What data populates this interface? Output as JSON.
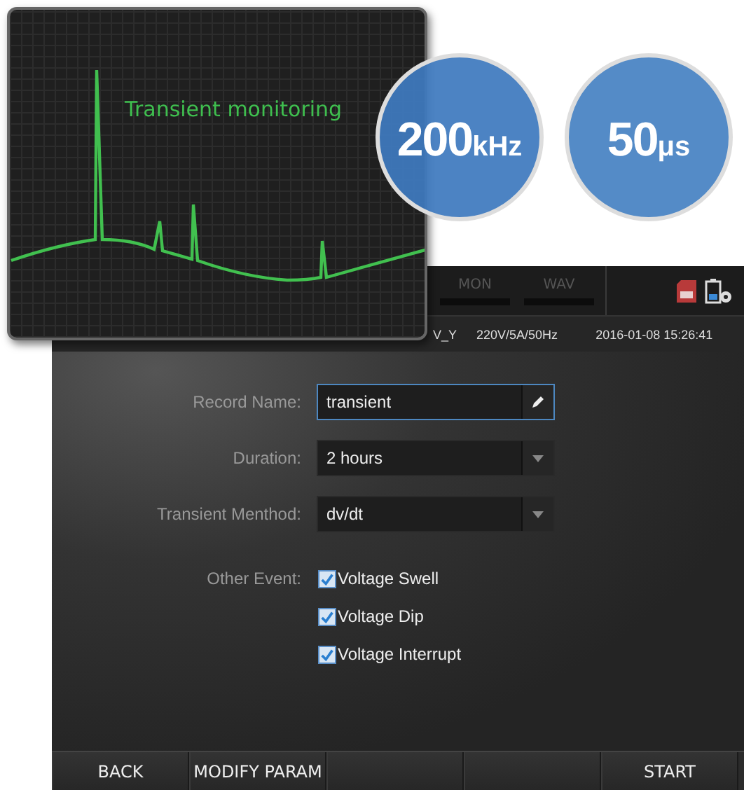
{
  "overlay": {
    "title": "Transient monitoring"
  },
  "badges": [
    {
      "value": "200",
      "unit": "kHz"
    },
    {
      "value": "50",
      "unit": "μs"
    }
  ],
  "header": {
    "tabs": [
      {
        "label": "MON"
      },
      {
        "label": "WAV"
      }
    ]
  },
  "status_bar": {
    "channel": "V_Y",
    "range": "220V/5A/50Hz",
    "datetime": "2016-01-08 15:26:41"
  },
  "form": {
    "record_name": {
      "label": "Record Name:",
      "value": "transient"
    },
    "duration": {
      "label": "Duration:",
      "value": "2 hours"
    },
    "method": {
      "label": "Transient Menthod:",
      "value": "dv/dt"
    },
    "other_event": {
      "label": "Other Event:",
      "options": [
        {
          "label": "Voltage Swell",
          "checked": true
        },
        {
          "label": "Voltage Dip",
          "checked": true
        },
        {
          "label": "Voltage Interrupt",
          "checked": true
        }
      ]
    }
  },
  "softkeys": [
    {
      "kind": "label",
      "label": "BACK"
    },
    {
      "kind": "label",
      "label": "MODIFY PARAM"
    },
    {
      "kind": "blank"
    },
    {
      "kind": "blank"
    },
    {
      "kind": "label",
      "label": "START"
    }
  ]
}
